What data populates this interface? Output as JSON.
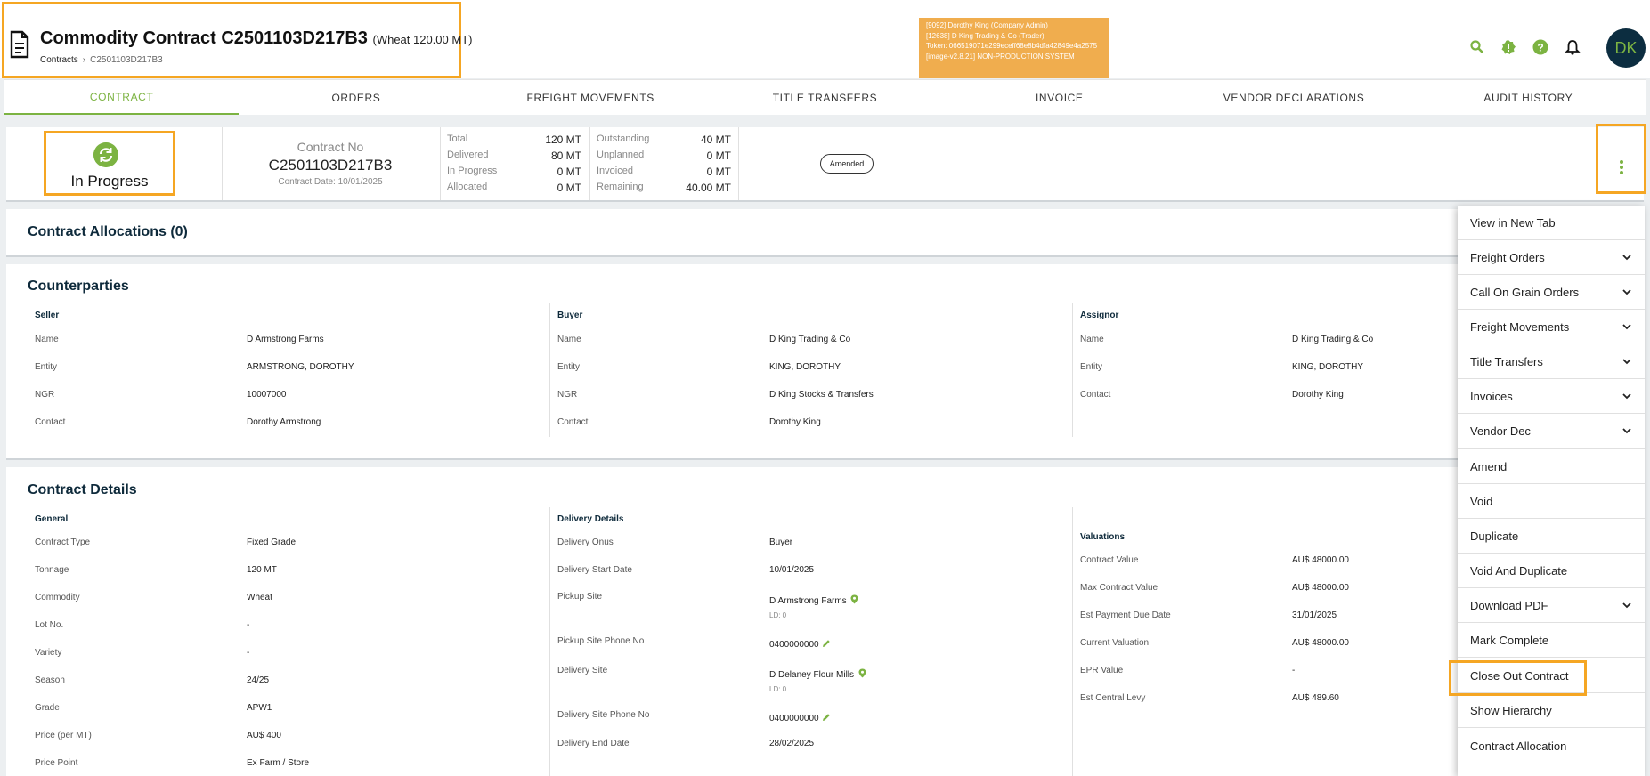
{
  "header": {
    "title": "Commodity Contract C2501103D217B3",
    "title_sub": "(Wheat 120.00 MT)",
    "breadcrumb_root": "Contracts",
    "breadcrumb_current": "C2501103D217B3",
    "env_lines": [
      "[9092] Dorothy King (Company Admin)",
      "[12638] D King Trading & Co (Trader)",
      "Token: 066519071e299eceff68e8b4dfa42849e4a2575",
      "[image-v2.8.21] NON-PRODUCTION SYSTEM"
    ],
    "avatar_initials": "DK",
    "accent": "#7cb342",
    "highlight": "#f5a623"
  },
  "tabs": [
    "CONTRACT",
    "ORDERS",
    "FREIGHT MOVEMENTS",
    "TITLE TRANSFERS",
    "INVOICE",
    "VENDOR DECLARATIONS",
    "AUDIT HISTORY"
  ],
  "status": {
    "state": "In Progress",
    "contract_no_label": "Contract No",
    "contract_no": "C2501103D217B3",
    "contract_date": "Contract Date: 10/01/2025",
    "left_stats": [
      {
        "label": "Total",
        "value": "120 MT"
      },
      {
        "label": "Delivered",
        "value": "80 MT"
      },
      {
        "label": "In Progress",
        "value": "0 MT"
      },
      {
        "label": "Allocated",
        "value": "0 MT"
      }
    ],
    "right_stats": [
      {
        "label": "Outstanding",
        "value": "40 MT"
      },
      {
        "label": "Unplanned",
        "value": "0 MT"
      },
      {
        "label": "Invoiced",
        "value": "0 MT"
      },
      {
        "label": "Remaining",
        "value": "40.00 MT"
      }
    ],
    "badge": "Amended"
  },
  "allocations": {
    "title": "Contract Allocations (0)"
  },
  "counterparties": {
    "title": "Counterparties",
    "seller": {
      "head": "Seller",
      "rows": [
        [
          "Name",
          "D Armstrong Farms"
        ],
        [
          "Entity",
          "ARMSTRONG, DOROTHY"
        ],
        [
          "NGR",
          "10007000"
        ],
        [
          "Contact",
          "Dorothy Armstrong"
        ]
      ]
    },
    "buyer": {
      "head": "Buyer",
      "rows": [
        [
          "Name",
          "D King Trading & Co"
        ],
        [
          "Entity",
          "KING, DOROTHY"
        ],
        [
          "NGR",
          "D King Stocks & Transfers"
        ],
        [
          "Contact",
          "Dorothy King"
        ]
      ]
    },
    "assignor": {
      "head": "Assignor",
      "rows": [
        [
          "Name",
          "D King Trading & Co"
        ],
        [
          "Entity",
          "KING, DOROTHY"
        ],
        [
          "Contact",
          "Dorothy King"
        ]
      ]
    }
  },
  "details": {
    "title": "Contract Details",
    "general": {
      "head": "General",
      "rows": [
        [
          "Contract Type",
          "Fixed Grade"
        ],
        [
          "Tonnage",
          "120 MT"
        ],
        [
          "Commodity",
          "Wheat"
        ],
        [
          "Lot No.",
          "-"
        ],
        [
          "Variety",
          "-"
        ],
        [
          "Season",
          "24/25"
        ],
        [
          "Grade",
          "APW1"
        ],
        [
          "Price (per MT)",
          "AU$ 400"
        ],
        [
          "Price Point",
          "Ex Farm / Store"
        ]
      ]
    },
    "delivery": {
      "head": "Delivery Details",
      "onus_label": "Delivery Onus",
      "onus": "Buyer",
      "start_label": "Delivery Start Date",
      "start": "10/01/2025",
      "pickup_label": "Pickup Site",
      "pickup": "D Armstrong Farms",
      "pickup_ld": "LD: 0",
      "pickup_phone_label": "Pickup Site Phone No",
      "pickup_phone": "0400000000",
      "delivery_site_label": "Delivery Site",
      "delivery_site": "D Delaney Flour Mills",
      "delivery_ld": "LD: 0",
      "delivery_phone_label": "Delivery Site Phone No",
      "delivery_phone": "0400000000",
      "end_label": "Delivery End Date",
      "end": "28/02/2025"
    },
    "valuations": {
      "head": "Valuations",
      "rows": [
        [
          "Contract Value",
          "AU$ 48000.00"
        ],
        [
          "Max Contract Value",
          "AU$ 48000.00"
        ],
        [
          "Est Payment Due Date",
          "31/01/2025"
        ],
        [
          "Current Valuation",
          "AU$ 48000.00"
        ],
        [
          "EPR Value",
          "-"
        ],
        [
          "Est Central Levy",
          "AU$ 489.60"
        ]
      ]
    }
  },
  "menu": [
    {
      "label": "View in New Tab",
      "chevron": false
    },
    {
      "label": "Freight Orders",
      "chevron": true
    },
    {
      "label": "Call On Grain Orders",
      "chevron": true
    },
    {
      "label": "Freight Movements",
      "chevron": true
    },
    {
      "label": "Title Transfers",
      "chevron": true
    },
    {
      "label": "Invoices",
      "chevron": true
    },
    {
      "label": "Vendor Dec",
      "chevron": true
    },
    {
      "label": "Amend",
      "chevron": false
    },
    {
      "label": "Void",
      "chevron": false
    },
    {
      "label": "Duplicate",
      "chevron": false
    },
    {
      "label": "Void And Duplicate",
      "chevron": false
    },
    {
      "label": "Download PDF",
      "chevron": true
    },
    {
      "label": "Mark Complete",
      "chevron": false
    },
    {
      "label": "Close Out Contract",
      "chevron": false
    },
    {
      "label": "Show Hierarchy",
      "chevron": false
    },
    {
      "label": "Contract Allocation",
      "chevron": false
    }
  ]
}
